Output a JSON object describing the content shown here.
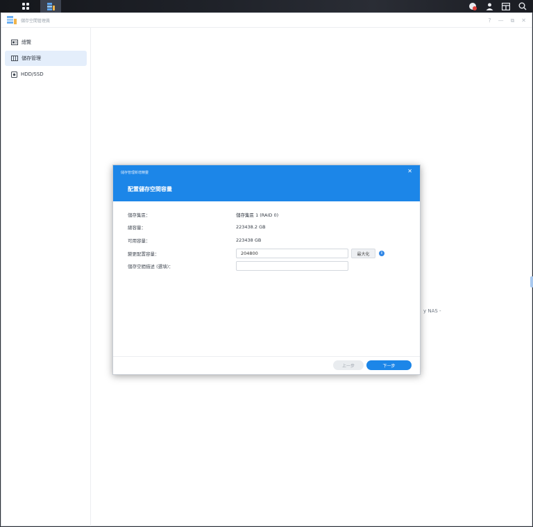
{
  "window": {
    "title": "儲存空間管理員",
    "controls": {
      "help": "?",
      "minimize": "—",
      "maximize": "⧉",
      "close": "✕"
    }
  },
  "sidebar": {
    "items": [
      {
        "label": "總覽",
        "icon": "overview-icon",
        "active": false
      },
      {
        "label": "儲存管理",
        "icon": "storage-icon",
        "active": true
      },
      {
        "label": "HDD/SSD",
        "icon": "disk-icon",
        "active": false
      }
    ]
  },
  "background": {
    "partial_text": "y NAS -"
  },
  "dialog": {
    "wizard_name": "儲存管理新增精靈",
    "title": "配置儲存空間容量",
    "close": "✕",
    "fields": [
      {
        "label": "儲存集區：",
        "value": "儲存集區 1 (RAID 0)"
      },
      {
        "label": "總容量：",
        "value": "223438.2 GB"
      },
      {
        "label": "可用容量：",
        "value": "223438 GB"
      }
    ],
    "allocate": {
      "label": "變更配置容量：",
      "value": "204800",
      "max_button": "最大化",
      "info": "i"
    },
    "description": {
      "label": "儲存空間描述 (選填)：",
      "value": ""
    },
    "buttons": {
      "prev": "上一步",
      "next": "下一步"
    }
  },
  "colors": {
    "accent": "#1c86e8",
    "sidebar_active": "#e4eefb"
  }
}
